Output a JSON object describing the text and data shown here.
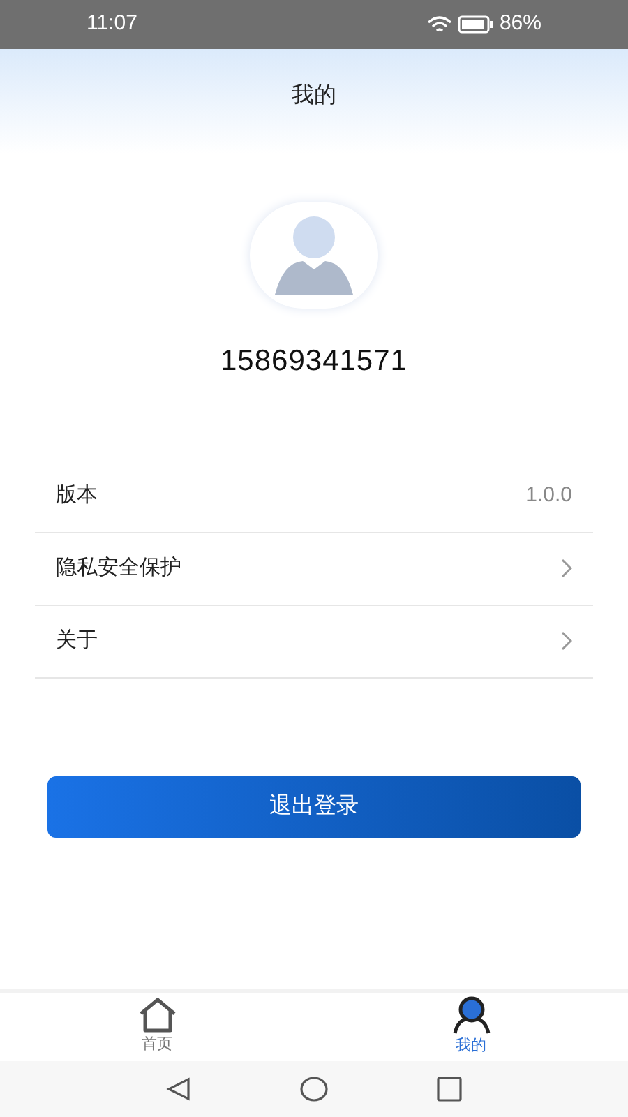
{
  "status_bar": {
    "time": "11:07",
    "battery": "86%"
  },
  "header": {
    "title": "我的"
  },
  "profile": {
    "phone": "15869341571"
  },
  "menu": [
    {
      "kind": "value",
      "label": "版本",
      "value": "1.0.0"
    },
    {
      "kind": "link",
      "label": "隐私安全保护"
    },
    {
      "kind": "link",
      "label": "关于"
    }
  ],
  "logout_button": "退出登录",
  "tabs": [
    {
      "kind": "home",
      "label": "首页",
      "selected": false
    },
    {
      "kind": "me",
      "label": "我的",
      "selected": true
    }
  ]
}
